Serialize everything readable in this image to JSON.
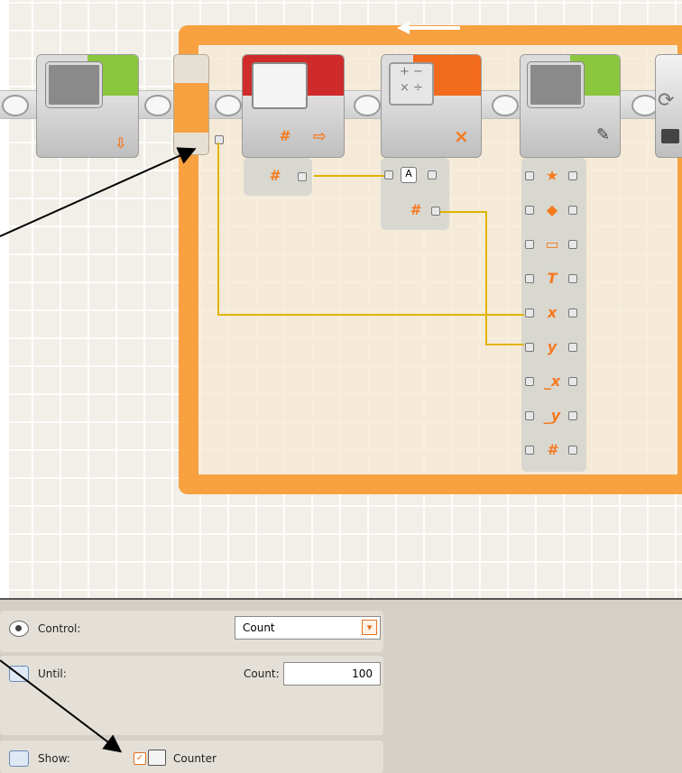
{
  "panel": {
    "control_label": "Control:",
    "control_value": "Count",
    "until_label": "Until:",
    "count_label": "Count:",
    "count_value": "100",
    "show_label": "Show:",
    "show_counter_label": "Counter",
    "show_counter_checked": true
  },
  "blocks": {
    "variable_hash": "#",
    "math_symbol": "×",
    "math_input_a": "A",
    "math_input_hash": "#",
    "display_ports": [
      "★",
      "◆",
      "▭",
      "T",
      "x",
      "y",
      "_x",
      "_y",
      "#"
    ]
  },
  "colors": {
    "loop": "#f7a141",
    "wire": "#e0b400",
    "display_green": "#8bc63f",
    "variable_red": "#d02b2b",
    "math_orange": "#f26a1b",
    "port_orange": "#f47a20"
  },
  "icons": [
    "screen-icon",
    "download-icon",
    "folder-icon",
    "arrow-right-icon",
    "calculator-icon",
    "pencil-icon",
    "loop-icon",
    "counter-icon",
    "eye-icon",
    "until-icon",
    "show-icon",
    "dropdown-arrow-icon"
  ]
}
